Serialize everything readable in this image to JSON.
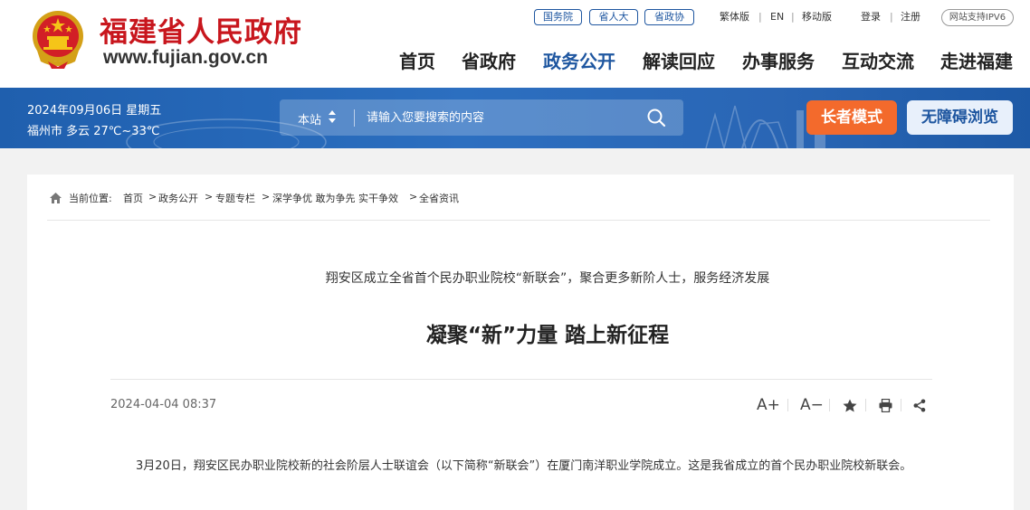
{
  "site": {
    "title": "福建省人民政府",
    "url": "www.fujian.gov.cn"
  },
  "top_links": {
    "state_council": "国务院",
    "provincial_congress": "省人大",
    "cppcc": "省政协",
    "traditional": "繁体版",
    "english": "EN",
    "mobile": "移动版",
    "login": "登录",
    "register": "注册",
    "ipv6": "网站支持IPV6"
  },
  "nav": {
    "items": [
      {
        "label": "首页"
      },
      {
        "label": "省政府"
      },
      {
        "label": "政务公开"
      },
      {
        "label": "解读回应"
      },
      {
        "label": "办事服务"
      },
      {
        "label": "互动交流"
      },
      {
        "label": "走进福建"
      }
    ],
    "active_index": 2
  },
  "banner": {
    "date": "2024年09月06日 星期五",
    "weather": "福州市 多云 27℃~33℃",
    "search_scope": "本站",
    "search_placeholder": "请输入您要搜索的内容",
    "elder_mode": "长者模式",
    "accessible": "无障碍浏览"
  },
  "breadcrumb": {
    "prefix": "当前位置:",
    "items": [
      "首页",
      "政务公开",
      "专题专栏",
      "深学争优 敢为争先 实干争效",
      "全省资讯"
    ]
  },
  "article": {
    "subtitle": "翔安区成立全省首个民办职业院校“新联会”，聚合更多新阶人士，服务经济发展",
    "title": "凝聚“新”力量 踏上新征程",
    "date": "2024-04-04 08:37",
    "font_larger": "A+",
    "font_smaller": "A−",
    "paragraph": "3月20日，翔安区民办职业院校新的社会阶层人士联谊会（以下简称“新联会”）在厦门南洋职业学院成立。这是我省成立的首个民办职业院校新联会。"
  },
  "colors": {
    "brand_red": "#c8161d",
    "nav_blue": "#1e56a0",
    "banner_blue": "#2a66b5",
    "elder_orange": "#f36a2c"
  }
}
